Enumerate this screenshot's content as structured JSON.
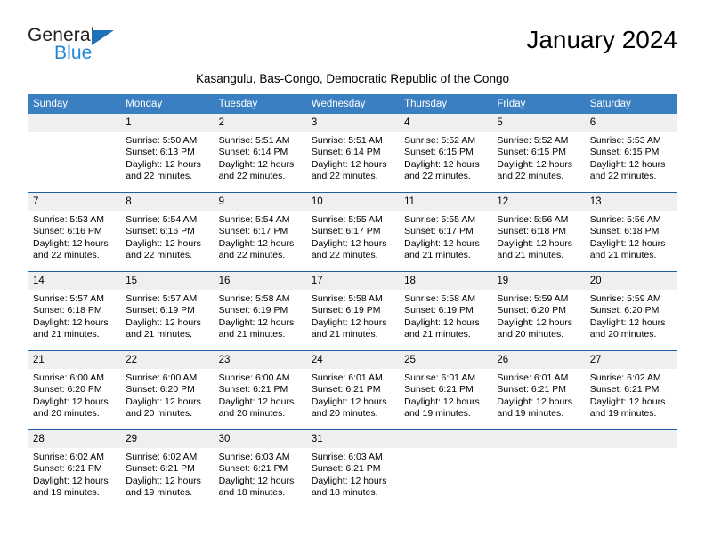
{
  "brand": {
    "name_part1": "General",
    "name_part2": "Blue",
    "accent_color": "#2487d6",
    "logo_triangle_color": "#1e71b8"
  },
  "header": {
    "month_title": "January 2024",
    "location": "Kasangulu, Bas-Congo, Democratic Republic of the Congo"
  },
  "theme": {
    "header_row_bg": "#3a7fc1",
    "daynum_bg": "#efefef",
    "week_separator": "#1f5fa0"
  },
  "weekdays": [
    "Sunday",
    "Monday",
    "Tuesday",
    "Wednesday",
    "Thursday",
    "Friday",
    "Saturday"
  ],
  "weeks": [
    [
      {
        "day": "",
        "sunrise": "",
        "sunset": "",
        "daylight1": "",
        "daylight2": "",
        "empty": true
      },
      {
        "day": "1",
        "sunrise": "Sunrise: 5:50 AM",
        "sunset": "Sunset: 6:13 PM",
        "daylight1": "Daylight: 12 hours",
        "daylight2": "and 22 minutes."
      },
      {
        "day": "2",
        "sunrise": "Sunrise: 5:51 AM",
        "sunset": "Sunset: 6:14 PM",
        "daylight1": "Daylight: 12 hours",
        "daylight2": "and 22 minutes."
      },
      {
        "day": "3",
        "sunrise": "Sunrise: 5:51 AM",
        "sunset": "Sunset: 6:14 PM",
        "daylight1": "Daylight: 12 hours",
        "daylight2": "and 22 minutes."
      },
      {
        "day": "4",
        "sunrise": "Sunrise: 5:52 AM",
        "sunset": "Sunset: 6:15 PM",
        "daylight1": "Daylight: 12 hours",
        "daylight2": "and 22 minutes."
      },
      {
        "day": "5",
        "sunrise": "Sunrise: 5:52 AM",
        "sunset": "Sunset: 6:15 PM",
        "daylight1": "Daylight: 12 hours",
        "daylight2": "and 22 minutes."
      },
      {
        "day": "6",
        "sunrise": "Sunrise: 5:53 AM",
        "sunset": "Sunset: 6:15 PM",
        "daylight1": "Daylight: 12 hours",
        "daylight2": "and 22 minutes."
      }
    ],
    [
      {
        "day": "7",
        "sunrise": "Sunrise: 5:53 AM",
        "sunset": "Sunset: 6:16 PM",
        "daylight1": "Daylight: 12 hours",
        "daylight2": "and 22 minutes."
      },
      {
        "day": "8",
        "sunrise": "Sunrise: 5:54 AM",
        "sunset": "Sunset: 6:16 PM",
        "daylight1": "Daylight: 12 hours",
        "daylight2": "and 22 minutes."
      },
      {
        "day": "9",
        "sunrise": "Sunrise: 5:54 AM",
        "sunset": "Sunset: 6:17 PM",
        "daylight1": "Daylight: 12 hours",
        "daylight2": "and 22 minutes."
      },
      {
        "day": "10",
        "sunrise": "Sunrise: 5:55 AM",
        "sunset": "Sunset: 6:17 PM",
        "daylight1": "Daylight: 12 hours",
        "daylight2": "and 22 minutes."
      },
      {
        "day": "11",
        "sunrise": "Sunrise: 5:55 AM",
        "sunset": "Sunset: 6:17 PM",
        "daylight1": "Daylight: 12 hours",
        "daylight2": "and 21 minutes."
      },
      {
        "day": "12",
        "sunrise": "Sunrise: 5:56 AM",
        "sunset": "Sunset: 6:18 PM",
        "daylight1": "Daylight: 12 hours",
        "daylight2": "and 21 minutes."
      },
      {
        "day": "13",
        "sunrise": "Sunrise: 5:56 AM",
        "sunset": "Sunset: 6:18 PM",
        "daylight1": "Daylight: 12 hours",
        "daylight2": "and 21 minutes."
      }
    ],
    [
      {
        "day": "14",
        "sunrise": "Sunrise: 5:57 AM",
        "sunset": "Sunset: 6:18 PM",
        "daylight1": "Daylight: 12 hours",
        "daylight2": "and 21 minutes."
      },
      {
        "day": "15",
        "sunrise": "Sunrise: 5:57 AM",
        "sunset": "Sunset: 6:19 PM",
        "daylight1": "Daylight: 12 hours",
        "daylight2": "and 21 minutes."
      },
      {
        "day": "16",
        "sunrise": "Sunrise: 5:58 AM",
        "sunset": "Sunset: 6:19 PM",
        "daylight1": "Daylight: 12 hours",
        "daylight2": "and 21 minutes."
      },
      {
        "day": "17",
        "sunrise": "Sunrise: 5:58 AM",
        "sunset": "Sunset: 6:19 PM",
        "daylight1": "Daylight: 12 hours",
        "daylight2": "and 21 minutes."
      },
      {
        "day": "18",
        "sunrise": "Sunrise: 5:58 AM",
        "sunset": "Sunset: 6:19 PM",
        "daylight1": "Daylight: 12 hours",
        "daylight2": "and 21 minutes."
      },
      {
        "day": "19",
        "sunrise": "Sunrise: 5:59 AM",
        "sunset": "Sunset: 6:20 PM",
        "daylight1": "Daylight: 12 hours",
        "daylight2": "and 20 minutes."
      },
      {
        "day": "20",
        "sunrise": "Sunrise: 5:59 AM",
        "sunset": "Sunset: 6:20 PM",
        "daylight1": "Daylight: 12 hours",
        "daylight2": "and 20 minutes."
      }
    ],
    [
      {
        "day": "21",
        "sunrise": "Sunrise: 6:00 AM",
        "sunset": "Sunset: 6:20 PM",
        "daylight1": "Daylight: 12 hours",
        "daylight2": "and 20 minutes."
      },
      {
        "day": "22",
        "sunrise": "Sunrise: 6:00 AM",
        "sunset": "Sunset: 6:20 PM",
        "daylight1": "Daylight: 12 hours",
        "daylight2": "and 20 minutes."
      },
      {
        "day": "23",
        "sunrise": "Sunrise: 6:00 AM",
        "sunset": "Sunset: 6:21 PM",
        "daylight1": "Daylight: 12 hours",
        "daylight2": "and 20 minutes."
      },
      {
        "day": "24",
        "sunrise": "Sunrise: 6:01 AM",
        "sunset": "Sunset: 6:21 PM",
        "daylight1": "Daylight: 12 hours",
        "daylight2": "and 20 minutes."
      },
      {
        "day": "25",
        "sunrise": "Sunrise: 6:01 AM",
        "sunset": "Sunset: 6:21 PM",
        "daylight1": "Daylight: 12 hours",
        "daylight2": "and 19 minutes."
      },
      {
        "day": "26",
        "sunrise": "Sunrise: 6:01 AM",
        "sunset": "Sunset: 6:21 PM",
        "daylight1": "Daylight: 12 hours",
        "daylight2": "and 19 minutes."
      },
      {
        "day": "27",
        "sunrise": "Sunrise: 6:02 AM",
        "sunset": "Sunset: 6:21 PM",
        "daylight1": "Daylight: 12 hours",
        "daylight2": "and 19 minutes."
      }
    ],
    [
      {
        "day": "28",
        "sunrise": "Sunrise: 6:02 AM",
        "sunset": "Sunset: 6:21 PM",
        "daylight1": "Daylight: 12 hours",
        "daylight2": "and 19 minutes."
      },
      {
        "day": "29",
        "sunrise": "Sunrise: 6:02 AM",
        "sunset": "Sunset: 6:21 PM",
        "daylight1": "Daylight: 12 hours",
        "daylight2": "and 19 minutes."
      },
      {
        "day": "30",
        "sunrise": "Sunrise: 6:03 AM",
        "sunset": "Sunset: 6:21 PM",
        "daylight1": "Daylight: 12 hours",
        "daylight2": "and 18 minutes."
      },
      {
        "day": "31",
        "sunrise": "Sunrise: 6:03 AM",
        "sunset": "Sunset: 6:21 PM",
        "daylight1": "Daylight: 12 hours",
        "daylight2": "and 18 minutes."
      },
      {
        "day": "",
        "sunrise": "",
        "sunset": "",
        "daylight1": "",
        "daylight2": "",
        "empty": true
      },
      {
        "day": "",
        "sunrise": "",
        "sunset": "",
        "daylight1": "",
        "daylight2": "",
        "empty": true
      },
      {
        "day": "",
        "sunrise": "",
        "sunset": "",
        "daylight1": "",
        "daylight2": "",
        "empty": true
      }
    ]
  ]
}
